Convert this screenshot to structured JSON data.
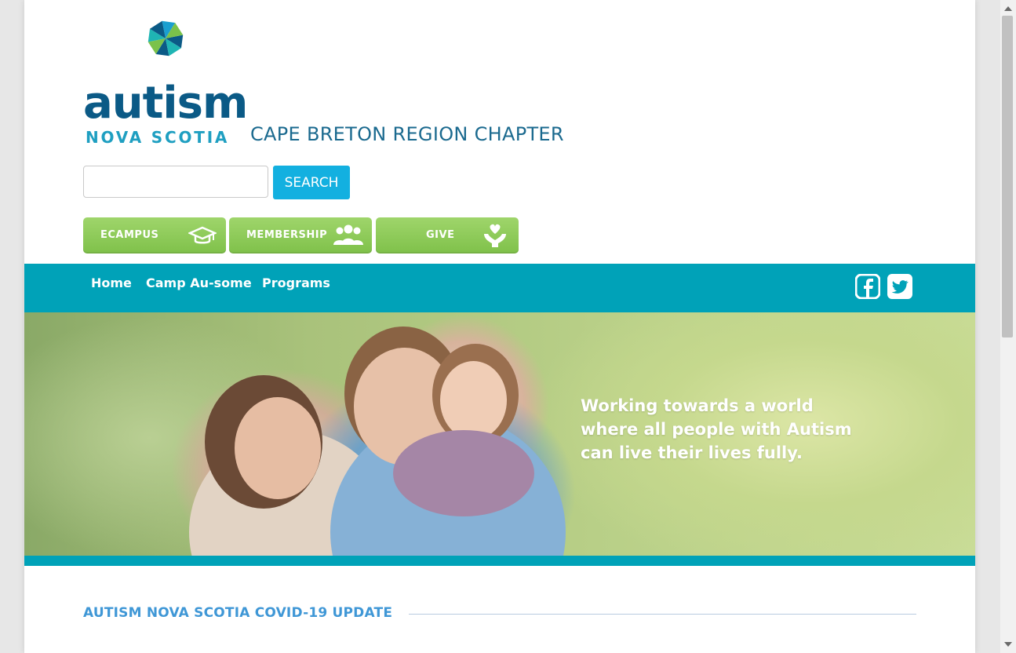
{
  "header": {
    "logo_word": "autism",
    "logo_sub": "NOVA SCOTIA",
    "chapter_title": "CAPE BRETON REGION CHAPTER"
  },
  "search": {
    "placeholder": "",
    "button_label": "SEARCH"
  },
  "quick_links": [
    {
      "label": "ECAMPUS",
      "icon": "graduation-cap-icon"
    },
    {
      "label": "MEMBERSHIP",
      "icon": "people-icon"
    },
    {
      "label": "GIVE",
      "icon": "heart-hands-icon"
    }
  ],
  "nav": {
    "items": [
      "Home",
      "Camp Au-some",
      "Programs"
    ],
    "social": [
      "facebook-icon",
      "twitter-icon"
    ]
  },
  "hero": {
    "line1": "Working towards a world",
    "line2": "where all people with Autism",
    "line3": "can live their lives fully."
  },
  "section": {
    "title": "AUTISM NOVA SCOTIA COVID-19 UPDATE"
  },
  "colors": {
    "brand_teal": "#00a2b8",
    "brand_navy": "#0b5a86",
    "quick_link_green": "#8dcb57",
    "search_blue": "#13b0e0",
    "heading_blue": "#3f97d6"
  }
}
